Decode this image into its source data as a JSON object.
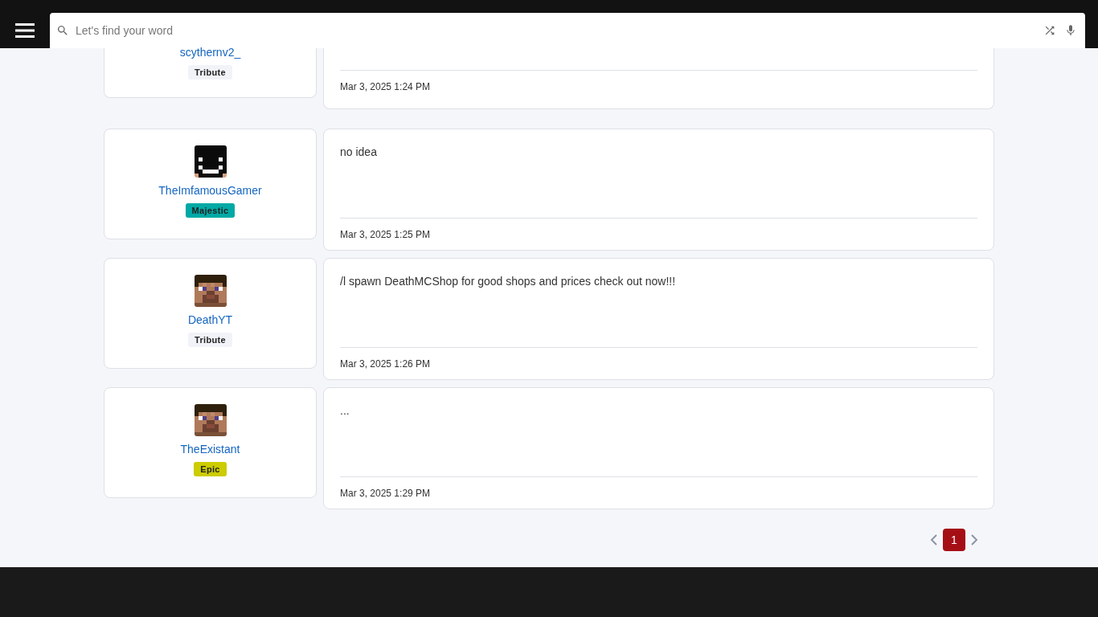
{
  "search": {
    "placeholder": "Let's find your word"
  },
  "posts": [
    {
      "kind": "partial",
      "author": "scythernv2_",
      "rank": {
        "label": "Tribute",
        "color": "#f1f3f8"
      },
      "date": "Mar 3, 2025 1:24 PM"
    },
    {
      "kind": "full",
      "author": "TheImfamousGamer",
      "avatar": {
        "kind": "dark"
      },
      "rank": {
        "label": "Majestic",
        "color": "#00a9a5"
      },
      "message": "no idea",
      "date": "Mar 3, 2025 1:25 PM"
    },
    {
      "kind": "full",
      "author": "DeathYT",
      "avatar": {
        "kind": "skin"
      },
      "rank": {
        "label": "Tribute",
        "color": "#f1f3f8"
      },
      "message": "/l spawn DeathMCShop for good shops and prices check out now!!!",
      "date": "Mar 3, 2025 1:26 PM"
    },
    {
      "kind": "full",
      "author": "TheExistant",
      "avatar": {
        "kind": "skin"
      },
      "rank": {
        "label": "Epic",
        "color": "#cccc00"
      },
      "message": "...",
      "date": "Mar 3, 2025 1:29 PM"
    }
  ],
  "pagination": {
    "pages": [
      {
        "label": "1",
        "selected": true
      }
    ]
  }
}
